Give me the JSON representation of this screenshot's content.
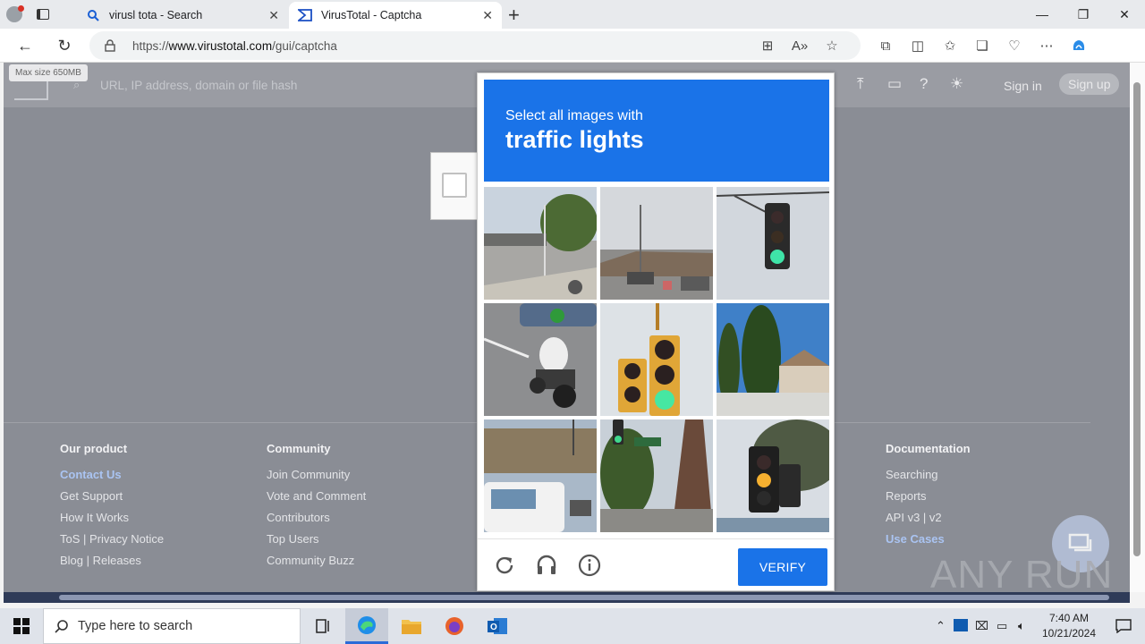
{
  "browser": {
    "tabs": [
      {
        "title": "virusl tota - Search",
        "active": false
      },
      {
        "title": "VirusTotal - Captcha",
        "active": true
      }
    ],
    "url_prefix": "https://",
    "url_domain": "www.virustotal.com",
    "url_path": "/gui/captcha"
  },
  "vt": {
    "max_size": "Max size 650MB",
    "search_placeholder": "URL, IP address, domain or file hash",
    "sign_in": "Sign in",
    "sign_up": "Sign up"
  },
  "footer": {
    "columns": [
      {
        "heading": "Our product",
        "links": [
          "Contact Us",
          "Get Support",
          "How It Works",
          "ToS | Privacy Notice",
          "Blog | Releases"
        ]
      },
      {
        "heading": "Community",
        "links": [
          "Join Community",
          "Vote and Comment",
          "Contributors",
          "Top Users",
          "Community Buzz"
        ]
      },
      {
        "heading": "Documentation",
        "links": [
          "Searching",
          "Reports",
          "API v3 | v2",
          "Use Cases"
        ]
      }
    ]
  },
  "captcha": {
    "prompt_small": "Select all images with",
    "prompt_big": "traffic lights",
    "verify_label": "VERIFY",
    "tiles": [
      "street-intersection",
      "street-cars",
      "traffic-light-green",
      "motorcycle-rider",
      "traffic-light-yellow-box",
      "cypress-trees",
      "street-truck",
      "street-sign-louise",
      "traffic-light-amber"
    ]
  },
  "watermark": "ANY RUN",
  "taskbar": {
    "search_placeholder": "Type here to search",
    "time": "7:40 AM",
    "date": "10/21/2024"
  },
  "colors": {
    "captcha_blue": "#1a73e8",
    "overlay": "#8a8d95"
  }
}
